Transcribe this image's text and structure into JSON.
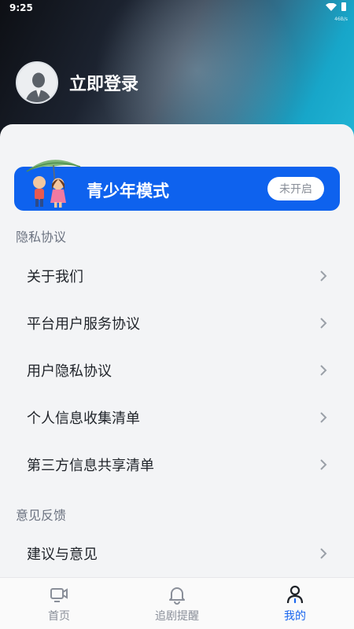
{
  "status_bar": {
    "time": "9:25",
    "net_speed": "46B/s"
  },
  "profile": {
    "login_label": "立即登录"
  },
  "youth_mode": {
    "title": "青少年模式",
    "status": "未开启"
  },
  "privacy_section": {
    "title": "隐私协议",
    "items": [
      {
        "label": "关于我们"
      },
      {
        "label": "平台用户服务协议"
      },
      {
        "label": "用户隐私协议"
      },
      {
        "label": "个人信息收集清单"
      },
      {
        "label": "第三方信息共享清单"
      }
    ]
  },
  "feedback_section": {
    "title": "意见反馈",
    "items": [
      {
        "label": "建议与意见"
      }
    ]
  },
  "tabbar": {
    "items": [
      {
        "label": "首页",
        "icon": "tv-icon"
      },
      {
        "label": "追剧提醒",
        "icon": "bell-icon"
      },
      {
        "label": "我的",
        "icon": "user-icon"
      }
    ],
    "active_index": 2
  },
  "colors": {
    "accent": "#1a66ee",
    "banner": "#0e62ee"
  }
}
